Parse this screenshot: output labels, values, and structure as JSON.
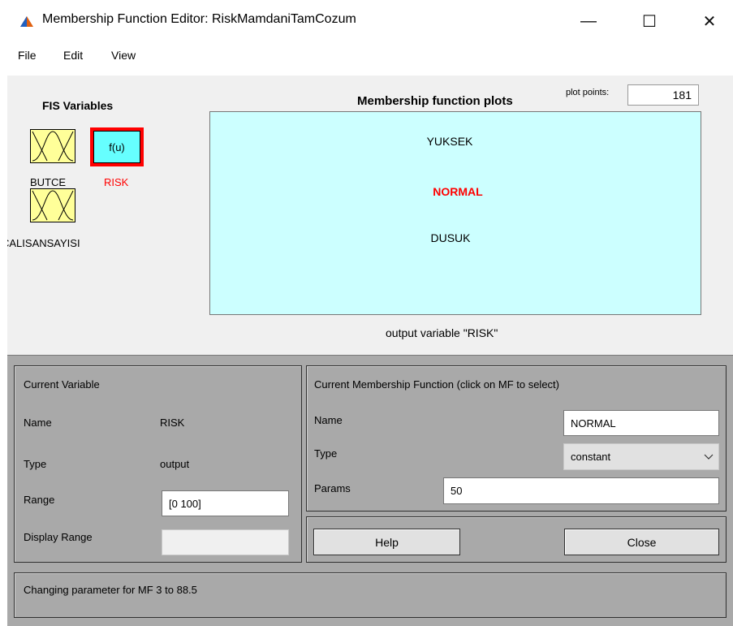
{
  "window": {
    "title": "Membership Function Editor: RiskMamdaniTamCozum",
    "controls": {
      "minimize": "—",
      "maximize": "☐",
      "close": "✕"
    }
  },
  "menu": {
    "items": [
      "File",
      "Edit",
      "View"
    ]
  },
  "fis_variables": {
    "heading": "FIS Variables",
    "inputs": [
      {
        "label": "BUTCE",
        "icon": "membership-curves-icon"
      },
      {
        "label": "CALISANSAYISI",
        "icon": "membership-curves-icon"
      }
    ],
    "output": {
      "label": "RISK",
      "box_text": "f(u)",
      "selected": true
    }
  },
  "plot": {
    "title": "Membership function plots",
    "points_label": "plot points:",
    "points_value": "181",
    "mf_labels": [
      {
        "text": "YUKSEK",
        "selected": false
      },
      {
        "text": "NORMAL",
        "selected": true
      },
      {
        "text": "DUSUK",
        "selected": false
      }
    ],
    "caption": "output variable \"RISK\""
  },
  "current_variable": {
    "title": "Current Variable",
    "name_label": "Name",
    "name_value": "RISK",
    "type_label": "Type",
    "type_value": "output",
    "range_label": "Range",
    "range_value": "[0 100]",
    "display_range_label": "Display Range",
    "display_range_value": ""
  },
  "current_mf": {
    "title": "Current Membership Function (click on MF to select)",
    "name_label": "Name",
    "name_value": "NORMAL",
    "type_label": "Type",
    "type_value": "constant",
    "params_label": "Params",
    "params_value": "50"
  },
  "buttons": {
    "help": "Help",
    "close": "Close"
  },
  "status": "Changing parameter for MF 3 to  88.5",
  "colors": {
    "selected_red": "#ff0000",
    "plot_bg": "#ccffff",
    "input_box": "#ffff99",
    "output_box": "#66ffff",
    "panel_grey": "#a9a9a9"
  }
}
